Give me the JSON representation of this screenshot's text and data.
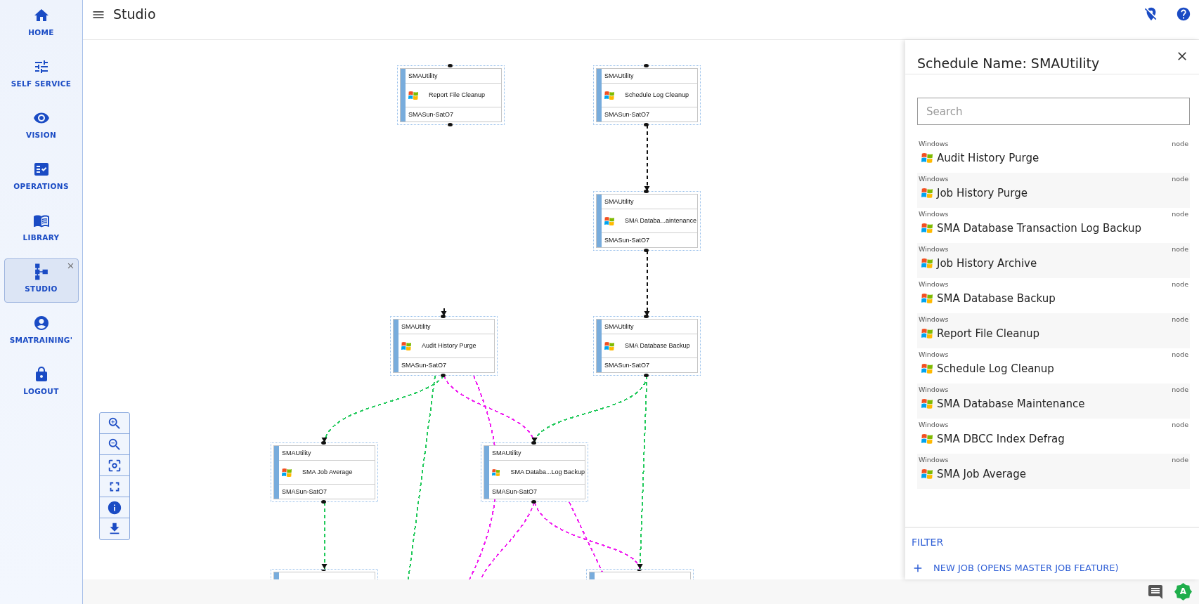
{
  "header": {
    "title": "Studio"
  },
  "sidebar": {
    "items": [
      {
        "label": "HOME",
        "kind": "home",
        "selected": false,
        "closable": false
      },
      {
        "label": "SELF SERVICE",
        "kind": "tune",
        "selected": false,
        "closable": false
      },
      {
        "label": "VISION",
        "kind": "eye",
        "selected": false,
        "closable": false
      },
      {
        "label": "OPERATIONS",
        "kind": "checklist",
        "selected": false,
        "closable": false
      },
      {
        "label": "LIBRARY",
        "kind": "book",
        "selected": false,
        "closable": false
      },
      {
        "label": "STUDIO",
        "kind": "tree",
        "selected": true,
        "closable": true
      },
      {
        "label": "SMATRAINING'",
        "kind": "account",
        "selected": false,
        "closable": false
      },
      {
        "label": "LOGOUT",
        "kind": "lock",
        "selected": false,
        "closable": false
      }
    ]
  },
  "canvas": {
    "nodes": [
      {
        "schedule": "SMAUtility",
        "name": "Report File Cleanup",
        "calendar": "SMASun-SatO7"
      },
      {
        "schedule": "SMAUtility",
        "name": "Schedule Log Cleanup",
        "calendar": "SMASun-SatO7"
      },
      {
        "schedule": "SMAUtility",
        "name": "SMA Databa...aintenance",
        "calendar": "SMASun-SatO7"
      },
      {
        "schedule": "SMAUtility",
        "name": "Audit History Purge",
        "calendar": "SMASun-SatO7"
      },
      {
        "schedule": "SMAUtility",
        "name": "SMA Database Backup",
        "calendar": "SMASun-SatO7"
      },
      {
        "schedule": "SMAUtility",
        "name": "SMA Job Average",
        "calendar": "SMASun-SatO7"
      },
      {
        "schedule": "SMAUtility",
        "name": "SMA Databa...Log Backup",
        "calendar": "SMASun-SatO7"
      }
    ],
    "links": [
      {
        "color": "#111111"
      },
      {
        "color": "#111111"
      },
      {
        "color": "#111111"
      },
      {
        "color": "#20c95a"
      },
      {
        "color": "#f01cf0"
      },
      {
        "color": "#f01cf0"
      },
      {
        "color": "#20c95a"
      },
      {
        "color": "#20c95a"
      },
      {
        "color": "#20c95a"
      },
      {
        "color": "#20c95a"
      },
      {
        "color": "#f01cf0"
      },
      {
        "color": "#f01cf0"
      },
      {
        "color": "#f01cf0"
      }
    ]
  },
  "panel": {
    "title": "Schedule Name: SMAUtility",
    "search": {
      "placeholder": "Search"
    },
    "jobs": [
      {
        "platform": "Windows",
        "type": "node",
        "name": "Audit History Purge"
      },
      {
        "platform": "Windows",
        "type": "node",
        "name": "Job History Purge"
      },
      {
        "platform": "Windows",
        "type": "node",
        "name": "SMA Database Transaction Log Backup"
      },
      {
        "platform": "Windows",
        "type": "node",
        "name": "Job History Archive"
      },
      {
        "platform": "Windows",
        "type": "node",
        "name": "SMA Database Backup"
      },
      {
        "platform": "Windows",
        "type": "node",
        "name": "Report File Cleanup"
      },
      {
        "platform": "Windows",
        "type": "node",
        "name": "Schedule Log Cleanup"
      },
      {
        "platform": "Windows",
        "type": "node",
        "name": "SMA Database Maintenance"
      },
      {
        "platform": "Windows",
        "type": "node",
        "name": "SMA DBCC Index Defrag"
      },
      {
        "platform": "Windows",
        "type": "node",
        "name": "SMA Job Average"
      }
    ],
    "filter_label": "FILTER",
    "new_job_label": "NEW JOB (OPENS MASTER JOB FEATURE)"
  },
  "footer": {
    "badge": "A"
  }
}
